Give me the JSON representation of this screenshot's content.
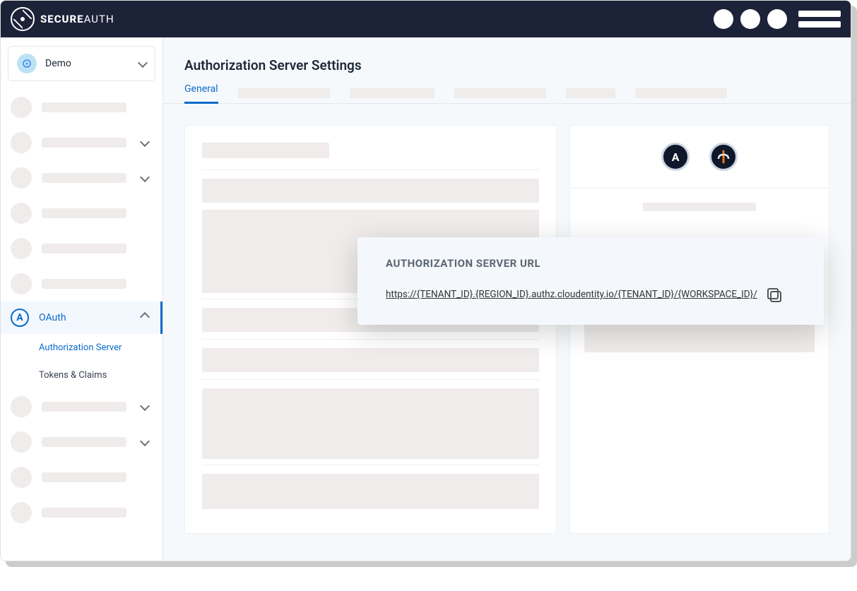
{
  "brand": {
    "name_bold": "SECURE",
    "name_light": "AUTH"
  },
  "workspace": {
    "label": "Demo"
  },
  "sidebar": {
    "oauth": {
      "label": "OAuth"
    },
    "subitems": [
      {
        "label": "Authorization Server"
      },
      {
        "label": "Tokens & Claims"
      }
    ]
  },
  "page": {
    "title": "Authorization Server Settings"
  },
  "tabs": {
    "active": "General"
  },
  "callout": {
    "title": "AUTHORIZATION SERVER URL",
    "url": "https://{TENANT_ID}.{REGION_ID}.authz.cloudentity.io/{TENANT_ID}/{WORKSPACE_ID}/"
  },
  "badges": {
    "oauth_letter": "A",
    "openid_symbol": "✦"
  }
}
